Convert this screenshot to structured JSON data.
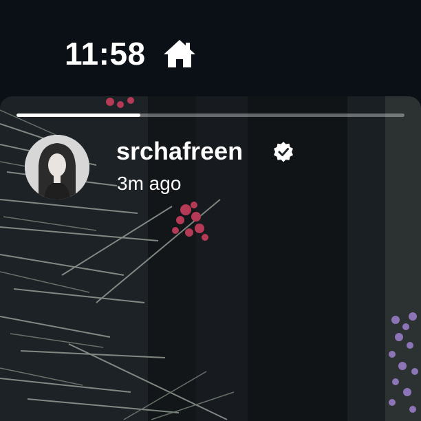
{
  "status_bar": {
    "time": "11:58",
    "icon": "home-icon"
  },
  "story": {
    "progress": 0.32,
    "username": "srchafreen",
    "verified": true,
    "verified_icon": "verified-badge-icon",
    "timestamp": "3m ago"
  },
  "colors": {
    "background": "#0b1016",
    "text": "#ffffff"
  }
}
